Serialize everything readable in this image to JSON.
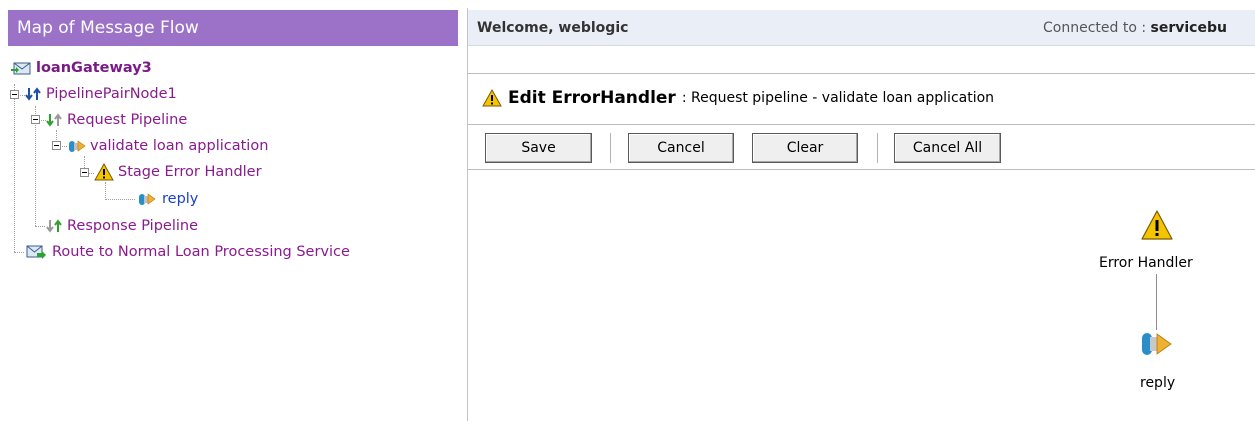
{
  "left_panel": {
    "title": "Map of Message Flow",
    "tree": {
      "root": "loanGateway3",
      "pipeline_pair": "PipelinePairNode1",
      "request_pipeline": "Request Pipeline",
      "stage": "validate loan application",
      "stage_error_handler": "Stage Error Handler",
      "reply": "reply",
      "response_pipeline": "Response Pipeline",
      "route": "Route to Normal Loan Processing Service"
    }
  },
  "header": {
    "welcome": "Welcome, weblogic",
    "connected_label": "Connected to :",
    "connected_server": "servicebu"
  },
  "edit": {
    "title": "Edit ErrorHandler",
    "subtitle": ": Request pipeline - validate loan application"
  },
  "toolbar": {
    "save": "Save",
    "cancel": "Cancel",
    "clear": "Clear",
    "cancel_all": "Cancel All"
  },
  "canvas": {
    "error_handler_label": "Error Handler",
    "reply_label": "reply"
  },
  "icons": {
    "root": "message-envelope-icon",
    "pipeline_pair": "pipeline-pair-icon",
    "stage": "stage-icon",
    "warning": "warning-icon",
    "route": "route-icon"
  },
  "colors": {
    "left_header": "#9b72c8",
    "tree_text": "#8a1a8f",
    "selected_text": "#1a3fd1",
    "welcome_bar": "#e9eef7"
  }
}
